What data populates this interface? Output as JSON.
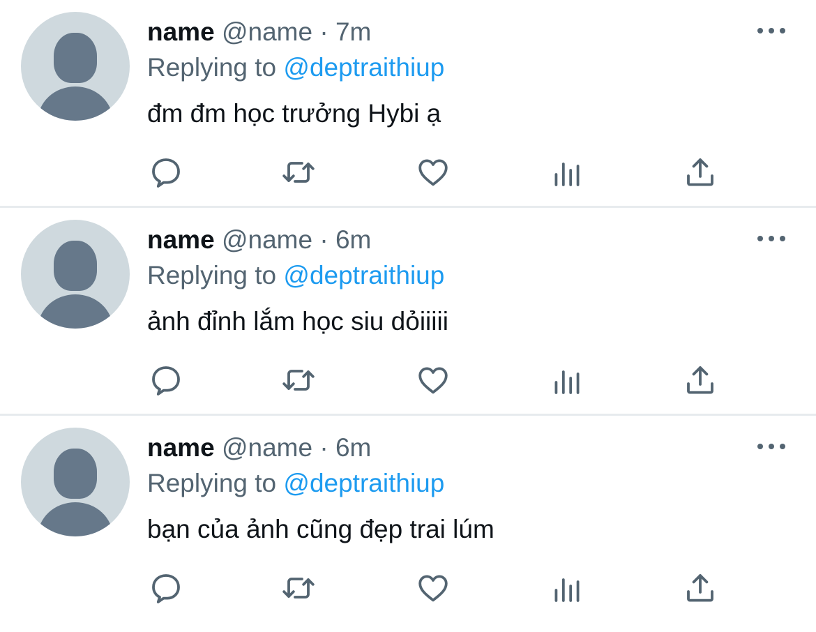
{
  "tweets": [
    {
      "name": "name",
      "handle": "@name",
      "separator": "·",
      "time": "7m",
      "replying_prefix": "Replying to",
      "replying_to": "@deptraithiup",
      "text": "đm đm học trưởng Hybi ạ"
    },
    {
      "name": "name",
      "handle": "@name",
      "separator": "·",
      "time": "6m",
      "replying_prefix": "Replying to",
      "replying_to": "@deptraithiup",
      "text": "ảnh đỉnh lắm học siu dỏiiiii"
    },
    {
      "name": "name",
      "handle": "@name",
      "separator": "·",
      "time": "6m",
      "replying_prefix": "Replying to",
      "replying_to": "@deptraithiup",
      "text": "bạn của ảnh cũng đẹp trai lúm"
    }
  ],
  "action_icons": [
    "reply-icon",
    "retweet-icon",
    "like-icon",
    "analytics-icon",
    "share-icon"
  ],
  "colors": {
    "text": "#0f1419",
    "secondary": "#536471",
    "link": "#1d9bf0",
    "avatar_bg": "#cfd9de",
    "avatar_fg": "#66788a",
    "divider": "#e7ebee"
  }
}
